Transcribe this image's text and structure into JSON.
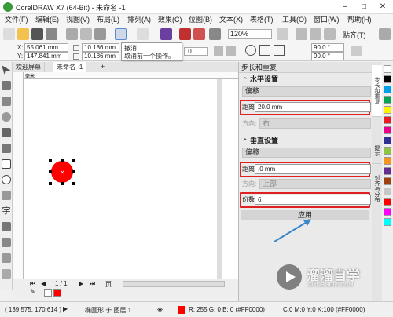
{
  "title": "CorelDRAW X7 (64-Bit) - 未命名 -1",
  "window_buttons": [
    "–",
    "□",
    "✕"
  ],
  "menu": [
    "文件(F)",
    "编辑(E)",
    "视图(V)",
    "布局(L)",
    "排列(A)",
    "效果(C)",
    "位图(B)",
    "文本(X)",
    "表格(T)",
    "工具(O)",
    "窗口(W)",
    "帮助(H)"
  ],
  "toolbar": {
    "zoom": "120%",
    "snap": "贴齐(T)"
  },
  "propbar": {
    "x": "55.061 mm",
    "y": "147.841 mm",
    "w": "10.186 mm",
    "h": "10.186 mm",
    "x_label": "X:",
    "y_label": "Y:",
    "w_value_short": ".0",
    "angle1": "90.0 °",
    "angle2": "90.0 °"
  },
  "tooltip": {
    "title": "撤消",
    "desc": "取消前一个操作。"
  },
  "doc_tabs": [
    "欢迎屏幕",
    "未命名 -1"
  ],
  "ruler_units": "毫米",
  "pagebar": {
    "page_indicator": "1 / 1",
    "page_label": "页"
  },
  "status": {
    "coords": "( 139.575, 170.614 )",
    "object_info": "椭圆形 于 图层 1",
    "fill_info": "R: 255 G: 0 B: 0 (#FF0000)",
    "outline_info": "C:0 M:0 Y:0 K:100 (#FF0000)"
  },
  "docker": {
    "title": "步长和重复",
    "horizontal": {
      "section": "水平设置",
      "mode": "偏移",
      "distance_label": "距离:",
      "distance": "20.0 mm",
      "direction_label": "方向:",
      "direction": "右"
    },
    "vertical": {
      "section": "垂直设置",
      "mode": "偏移",
      "distance_label": "距离:",
      "distance": ".0 mm",
      "direction_label": "方向:",
      "direction": "上部"
    },
    "copies_label": "份数:",
    "copies": "6",
    "apply": "应用"
  },
  "vtabs": [
    "步长和重复",
    "提示",
    "对齐与分布..."
  ],
  "palette_colors": [
    "#ffffff",
    "#000000",
    "#00a0e9",
    "#00a651",
    "#fff200",
    "#ed1c24",
    "#ec008c",
    "#2e3192",
    "#8dc63f",
    "#f7941d",
    "#662d91",
    "#a0410d",
    "#c7c7c7",
    "#ff0000",
    "#ff00ff",
    "#00ffff"
  ],
  "colors": {
    "accent_red": "#e02020",
    "circle_fill": "#ff0000",
    "arrow": "#3a86c8"
  },
  "watermark": {
    "brand": "溜溜自学",
    "url": "ZIXUE.3D66.COM"
  }
}
